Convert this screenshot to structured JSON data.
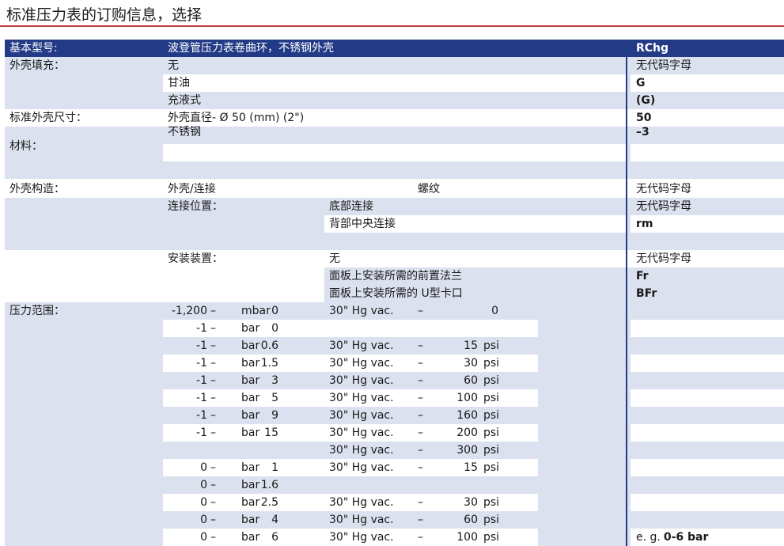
{
  "title": "标准压力表的订购信息，选择",
  "header": {
    "label": "基本型号:",
    "desc": "波登管压力表卷曲环，不锈钢外壳",
    "code": "RChg"
  },
  "case_fill": {
    "label": "外壳填充：",
    "items": [
      {
        "text": "无",
        "code": "无代码字母"
      },
      {
        "text": "甘油",
        "code": "G"
      },
      {
        "text": "充液式",
        "code": "(G)"
      }
    ]
  },
  "size": {
    "label": "标准外壳尺寸：",
    "text": "外壳直径- Ø 50 (mm) (2\")",
    "code": "50"
  },
  "material": {
    "label": "材料：",
    "text": "不锈钢",
    "code": "–3"
  },
  "construction": {
    "label": "外壳构造：",
    "case_conn": "外壳/连接",
    "thread": "螺纹",
    "thread_code": "无代码字母",
    "position_label": "连接位置：",
    "positions": [
      {
        "text": "底部连接",
        "code": "无代码字母"
      },
      {
        "text": "背部中央连接",
        "code": "rm"
      }
    ],
    "mounting_label": "安装装置：",
    "mountings": [
      {
        "text": "无",
        "code": "无代码字母"
      },
      {
        "text": "面板上安装所需的前置法兰",
        "code": "Fr"
      },
      {
        "text": "面板上安装所需的 U型卡口",
        "code": "BFr"
      }
    ]
  },
  "pressure": {
    "label": "压力范围：",
    "rows": [
      {
        "from": "-1,200",
        "to": "0",
        "unit": "mbar",
        "vac": "30\" Hg vac.",
        "psi": "0",
        "psi_unit": ""
      },
      {
        "from": "-1",
        "to": "0",
        "unit": "bar",
        "vac": "",
        "psi": "",
        "psi_unit": ""
      },
      {
        "from": "-1",
        "to": "0.6",
        "unit": "bar",
        "vac": "30\" Hg vac.",
        "psi": "15",
        "psi_unit": "psi"
      },
      {
        "from": "-1",
        "to": "1.5",
        "unit": "bar",
        "vac": "30\" Hg vac.",
        "psi": "30",
        "psi_unit": "psi"
      },
      {
        "from": "-1",
        "to": "3",
        "unit": "bar",
        "vac": "30\" Hg vac.",
        "psi": "60",
        "psi_unit": "psi"
      },
      {
        "from": "-1",
        "to": "5",
        "unit": "bar",
        "vac": "30\" Hg vac.",
        "psi": "100",
        "psi_unit": "psi"
      },
      {
        "from": "-1",
        "to": "9",
        "unit": "bar",
        "vac": "30\" Hg vac.",
        "psi": "160",
        "psi_unit": "psi"
      },
      {
        "from": "-1",
        "to": "15",
        "unit": "bar",
        "vac": "30\" Hg vac.",
        "psi": "200",
        "psi_unit": "psi"
      },
      {
        "from": "",
        "to": "",
        "unit": "",
        "vac": "30\" Hg vac.",
        "psi": "300",
        "psi_unit": "psi"
      },
      {
        "from": "0",
        "to": "1",
        "unit": "bar",
        "vac": "30\" Hg vac.",
        "psi": "15",
        "psi_unit": "psi"
      },
      {
        "from": "0",
        "to": "1.6",
        "unit": "bar",
        "vac": "",
        "psi": "",
        "psi_unit": ""
      },
      {
        "from": "0",
        "to": "2.5",
        "unit": "bar",
        "vac": "30\" Hg vac.",
        "psi": "30",
        "psi_unit": "psi"
      },
      {
        "from": "0",
        "to": "4",
        "unit": "bar",
        "vac": "30\" Hg vac.",
        "psi": "60",
        "psi_unit": "psi"
      },
      {
        "from": "0",
        "to": "6",
        "unit": "bar",
        "vac": "30\" Hg vac.",
        "psi": "100",
        "psi_unit": "psi"
      }
    ],
    "example_prefix": "e. g.",
    "example_value": "0-6 bar"
  },
  "dash": "–"
}
